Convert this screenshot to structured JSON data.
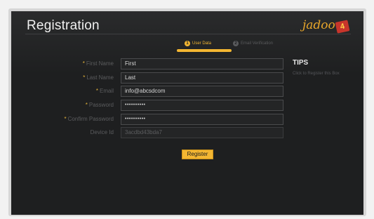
{
  "header": {
    "title": "Registration",
    "logo_text": "jadoo",
    "logo_badge": "4"
  },
  "steps": [
    {
      "number": "1",
      "label": "User Data",
      "active": true
    },
    {
      "number": "2",
      "label": "Email Verification",
      "active": false
    }
  ],
  "form": {
    "fields": [
      {
        "label": "First Name",
        "required": true,
        "value": "First"
      },
      {
        "label": "Last Name",
        "required": true,
        "value": "Last"
      },
      {
        "label": "Email",
        "required": true,
        "value": "info@abcsdcom"
      },
      {
        "label": "Password",
        "required": true,
        "value": "••••••••••"
      },
      {
        "label": "Confirm Password",
        "required": true,
        "value": "••••••••••"
      },
      {
        "label": "Device Id",
        "required": false,
        "value": "3acdbd43bda7"
      }
    ],
    "required_marker": "*",
    "submit_label": "Register"
  },
  "tips": {
    "heading": "TIPS",
    "text": "Click to Register this Box"
  },
  "colors": {
    "accent": "#f3b632",
    "screen_bg": "#1e1f20",
    "input_border": "#4a4b4d"
  }
}
